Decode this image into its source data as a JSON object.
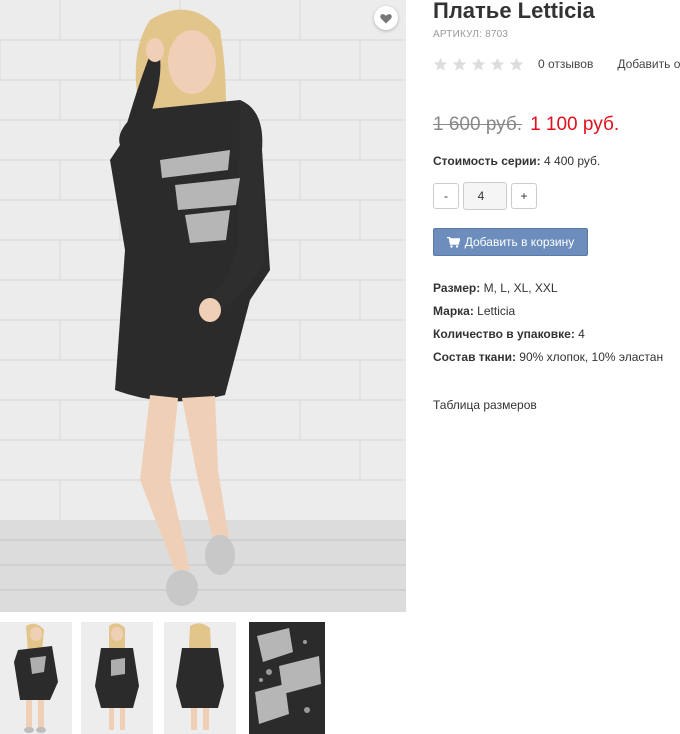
{
  "product": {
    "title": "Платье Letticia",
    "sku_label": "АРТИКУЛ:",
    "sku_value": "8703"
  },
  "rating": {
    "stars_filled": 0,
    "stars_total": 5,
    "reviews_label": "0 отзывов",
    "add_review_label": "Добавить отзыв"
  },
  "price": {
    "old": "1 600 руб.",
    "new": "1 100 руб."
  },
  "series": {
    "label": "Стоимость серии:",
    "value": "4 400 руб."
  },
  "quantity": {
    "minus_label": "-",
    "value": "4",
    "plus_label": "+"
  },
  "cart_button": {
    "label": "Добавить в корзину",
    "icon": "cart-icon"
  },
  "properties": [
    {
      "label": "Размер:",
      "value": "M, L, XL, XXL"
    },
    {
      "label": "Марка:",
      "value": "Letticia"
    },
    {
      "label": "Количество в упаковке:",
      "value": "4"
    },
    {
      "label": "Состав ткани:",
      "value": "90% хлопок, 10% эластан"
    }
  ],
  "size_table_link": "Таблица размеров",
  "gallery": {
    "favorite_icon": "heart-icon",
    "thumbnail_count": 4
  },
  "colors": {
    "price_new": "#e0101c",
    "cart_button": "#6d8ebd",
    "dress": "#2b2b2b"
  }
}
